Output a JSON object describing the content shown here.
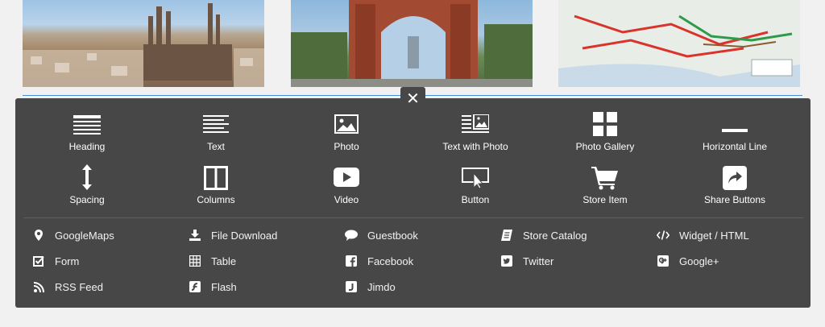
{
  "close_glyph": "✕",
  "elements": [
    {
      "label": "Heading",
      "icon": "heading-icon"
    },
    {
      "label": "Text",
      "icon": "text-icon"
    },
    {
      "label": "Photo",
      "icon": "photo-icon"
    },
    {
      "label": "Text with Photo",
      "icon": "text-with-photo-icon"
    },
    {
      "label": "Photo Gallery",
      "icon": "photo-gallery-icon"
    },
    {
      "label": "Horizontal Line",
      "icon": "horizontal-line-icon"
    },
    {
      "label": "Spacing",
      "icon": "spacing-icon"
    },
    {
      "label": "Columns",
      "icon": "columns-icon"
    },
    {
      "label": "Video",
      "icon": "video-icon"
    },
    {
      "label": "Button",
      "icon": "button-icon"
    },
    {
      "label": "Store Item",
      "icon": "cart-icon"
    },
    {
      "label": "Share Buttons",
      "icon": "share-icon"
    }
  ],
  "more_elements": [
    {
      "label": "GoogleMaps",
      "icon": "map-pin-icon"
    },
    {
      "label": "File Download",
      "icon": "download-icon"
    },
    {
      "label": "Guestbook",
      "icon": "comment-icon"
    },
    {
      "label": "Store Catalog",
      "icon": "catalog-icon"
    },
    {
      "label": "Widget / HTML",
      "icon": "code-icon"
    },
    {
      "label": "Form",
      "icon": "form-icon"
    },
    {
      "label": "Table",
      "icon": "table-icon"
    },
    {
      "label": "Facebook",
      "icon": "facebook-icon"
    },
    {
      "label": "Twitter",
      "icon": "twitter-icon"
    },
    {
      "label": "Google+",
      "icon": "google-plus-icon"
    },
    {
      "label": "RSS Feed",
      "icon": "rss-icon"
    },
    {
      "label": "Flash",
      "icon": "flash-icon"
    },
    {
      "label": "Jimdo",
      "icon": "jimdo-icon"
    }
  ],
  "colors": {
    "panel": "#474747",
    "accent_line": "#4a90d9",
    "text": "#ffffff"
  }
}
